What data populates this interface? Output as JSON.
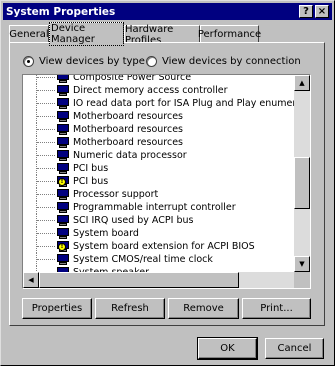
{
  "window": {
    "title": "System Properties",
    "help_label": "?",
    "close_label": "×"
  },
  "tabs": [
    {
      "label": "General"
    },
    {
      "label": "Device Manager"
    },
    {
      "label": "Hardware Profiles"
    },
    {
      "label": "Performance"
    }
  ],
  "view_options": {
    "by_type": "View devices by type",
    "by_connection": "View devices by connection",
    "selected": "View devices by type"
  },
  "devices": [
    {
      "label": "Composite Power Source",
      "icon": "device-icon"
    },
    {
      "label": "Direct memory access controller",
      "icon": "device-icon"
    },
    {
      "label": "IO read data port for ISA Plug and Play enumerator",
      "icon": "device-icon"
    },
    {
      "label": "Motherboard resources",
      "icon": "device-icon"
    },
    {
      "label": "Motherboard resources",
      "icon": "device-icon"
    },
    {
      "label": "Motherboard resources",
      "icon": "device-icon"
    },
    {
      "label": "Numeric data processor",
      "icon": "device-icon"
    },
    {
      "label": "PCI bus",
      "icon": "device-icon"
    },
    {
      "label": "PCI bus",
      "icon": "device-warning-icon"
    },
    {
      "label": "Processor support",
      "icon": "device-icon"
    },
    {
      "label": "Programmable interrupt controller",
      "icon": "device-icon"
    },
    {
      "label": "SCI IRQ used by ACPI bus",
      "icon": "device-icon"
    },
    {
      "label": "System board",
      "icon": "device-icon"
    },
    {
      "label": "System board extension for ACPI BIOS",
      "icon": "device-warning-icon"
    },
    {
      "label": "System CMOS/real time clock",
      "icon": "device-icon"
    },
    {
      "label": "System speaker",
      "icon": "device-icon"
    }
  ],
  "actions": {
    "properties": "Properties",
    "refresh": "Refresh",
    "remove": "Remove",
    "print": "Print..."
  },
  "dialog_buttons": {
    "ok": "OK",
    "cancel": "Cancel"
  }
}
